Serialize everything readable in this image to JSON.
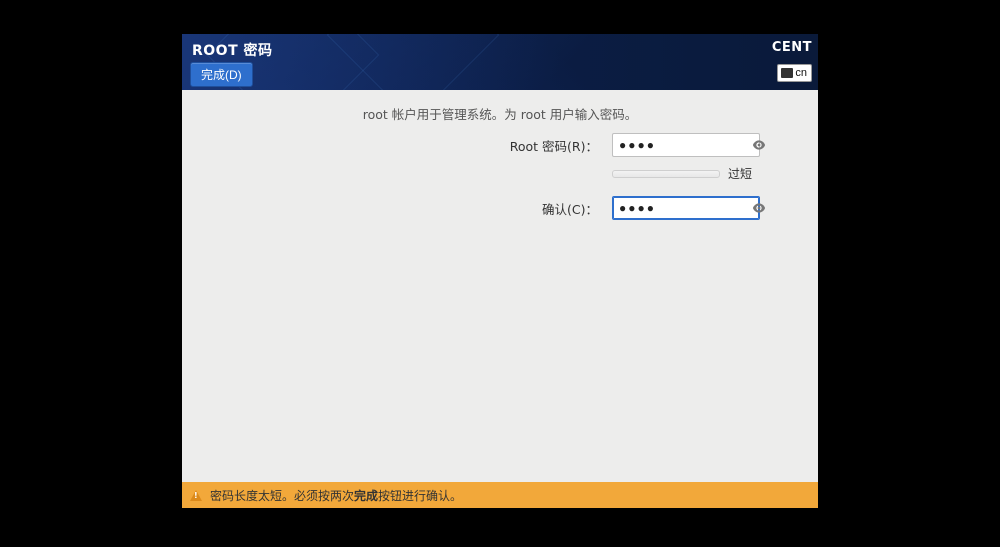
{
  "header": {
    "title": "ROOT 密码",
    "done_button": "完成(D)",
    "brand": "CENT",
    "keyboard_label": "cn"
  },
  "content": {
    "instruction": "root 帐户用于管理系统。为 root 用户输入密码。",
    "password_label": "Root 密码(R)：",
    "password_value": "●●●●",
    "confirm_label": "确认(C)：",
    "confirm_value": "●●●●",
    "strength_text": "过短"
  },
  "footer": {
    "warning_prefix": "密码长度太短。必须按两次",
    "warning_bold": "完成",
    "warning_suffix": "按钮进行确认。"
  }
}
